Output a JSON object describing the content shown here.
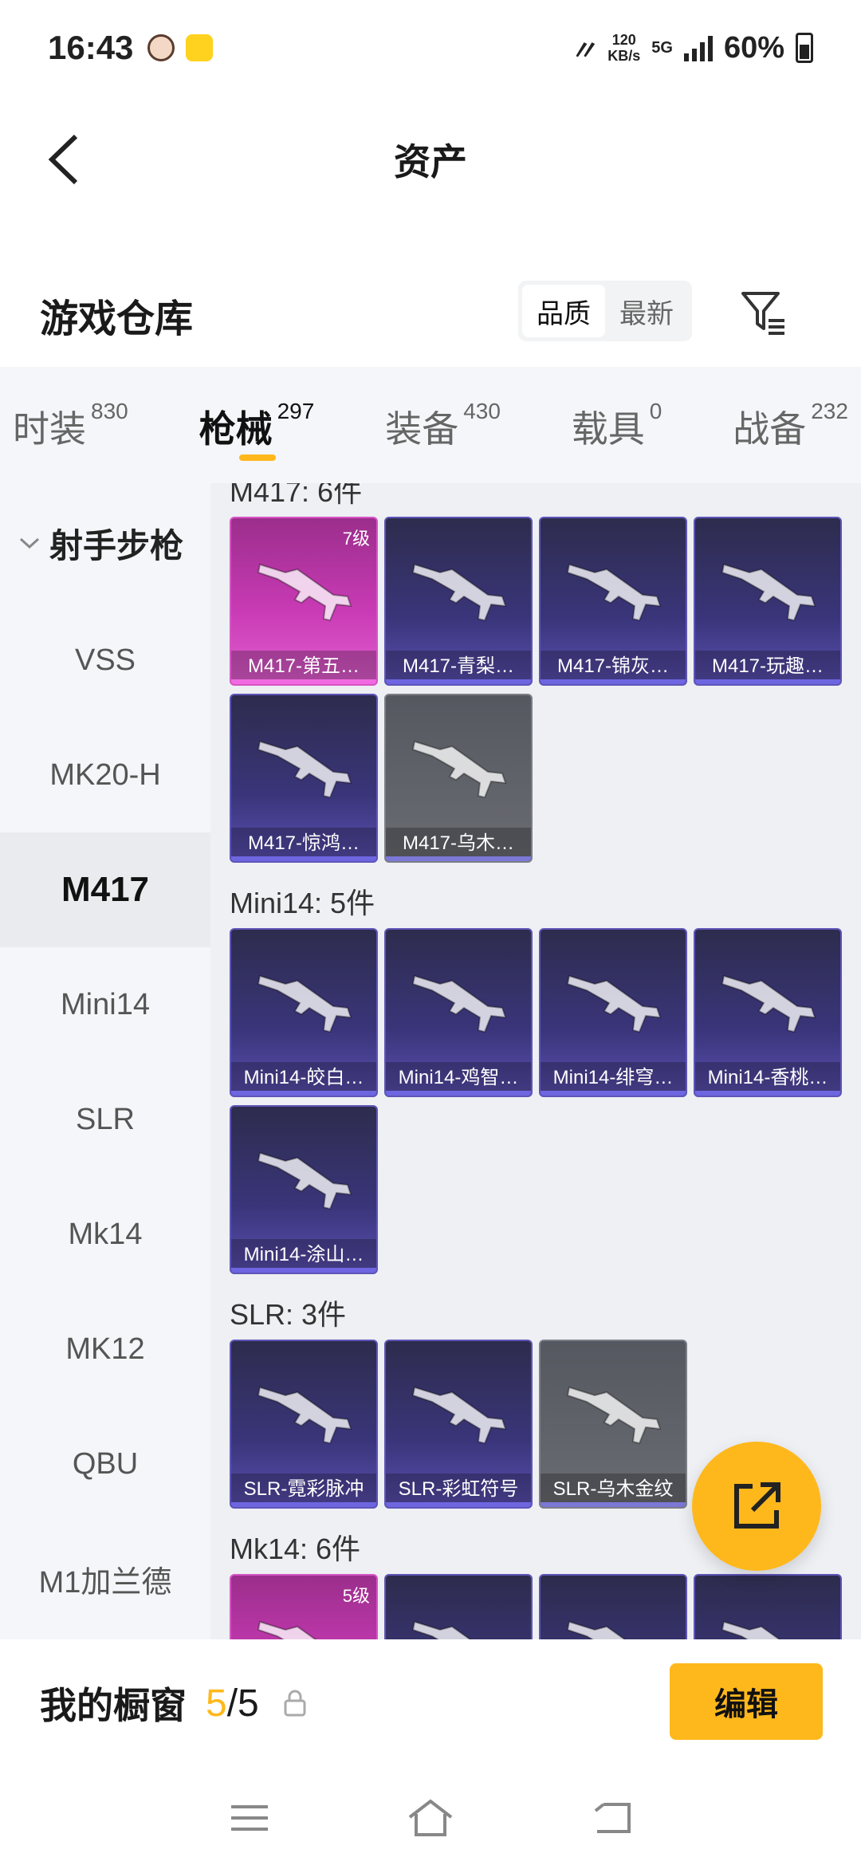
{
  "status_bar": {
    "time": "16:43",
    "net_speed_value": "120",
    "net_speed_unit": "KB/s",
    "network": "5G",
    "battery": "60%"
  },
  "header": {
    "title": "资产"
  },
  "warehouse": {
    "title": "游戏仓库",
    "sort_options": [
      "品质",
      "最新"
    ],
    "active_sort": "品质"
  },
  "tabs": [
    {
      "label": "时装",
      "count": "830"
    },
    {
      "label": "枪械",
      "count": "297",
      "active": true
    },
    {
      "label": "装备",
      "count": "430"
    },
    {
      "label": "载具",
      "count": "0"
    },
    {
      "label": "战备",
      "count": "232"
    }
  ],
  "sidebar": {
    "group": "射手步枪",
    "items": [
      "VSS",
      "MK20-H",
      "M417",
      "Mini14",
      "SLR",
      "Mk14",
      "MK12",
      "QBU",
      "M1加兰德"
    ],
    "active": "M417"
  },
  "sections": [
    {
      "title": "M417: 6件",
      "items": [
        {
          "name": "M417-第五…",
          "level": "7级",
          "style": "pink"
        },
        {
          "name": "M417-青梨…",
          "style": "purple"
        },
        {
          "name": "M417-锦灰…",
          "style": "purple"
        },
        {
          "name": "M417-玩趣…",
          "style": "purple"
        },
        {
          "name": "M417-惊鸿…",
          "style": "purple"
        },
        {
          "name": "M417-乌木…",
          "style": "gray"
        }
      ]
    },
    {
      "title": "Mini14: 5件",
      "items": [
        {
          "name": "Mini14-皎白…",
          "style": "purple"
        },
        {
          "name": "Mini14-鸡智…",
          "style": "purple"
        },
        {
          "name": "Mini14-绯穹…",
          "style": "purple"
        },
        {
          "name": "Mini14-香桃…",
          "style": "purple"
        },
        {
          "name": "Mini14-涂山…",
          "style": "purple"
        }
      ]
    },
    {
      "title": "SLR: 3件",
      "items": [
        {
          "name": "SLR-霓彩脉冲",
          "style": "purple"
        },
        {
          "name": "SLR-彩虹符号",
          "style": "purple"
        },
        {
          "name": "SLR-乌木金纹",
          "style": "gray"
        }
      ]
    },
    {
      "title": "Mk14: 6件",
      "items": [
        {
          "name": "",
          "level": "5级",
          "style": "pink"
        },
        {
          "name": "",
          "style": "purple"
        },
        {
          "name": "",
          "style": "purple"
        },
        {
          "name": "",
          "style": "purple"
        }
      ]
    }
  ],
  "showcase": {
    "title": "我的橱窗",
    "current": "5",
    "separator": "/",
    "total": "5",
    "edit_label": "编辑"
  },
  "colors": {
    "accent": "#ffb81c",
    "card_purple": "#3a357a",
    "card_pink": "#c83ab4",
    "card_gray": "#6a6c72"
  },
  "icons": {
    "back": "chevron-left-icon",
    "filter": "filter-icon",
    "fab": "share-external-icon",
    "lock": "lock-icon",
    "nav": [
      "menu-icon",
      "home-icon",
      "back-icon"
    ]
  }
}
